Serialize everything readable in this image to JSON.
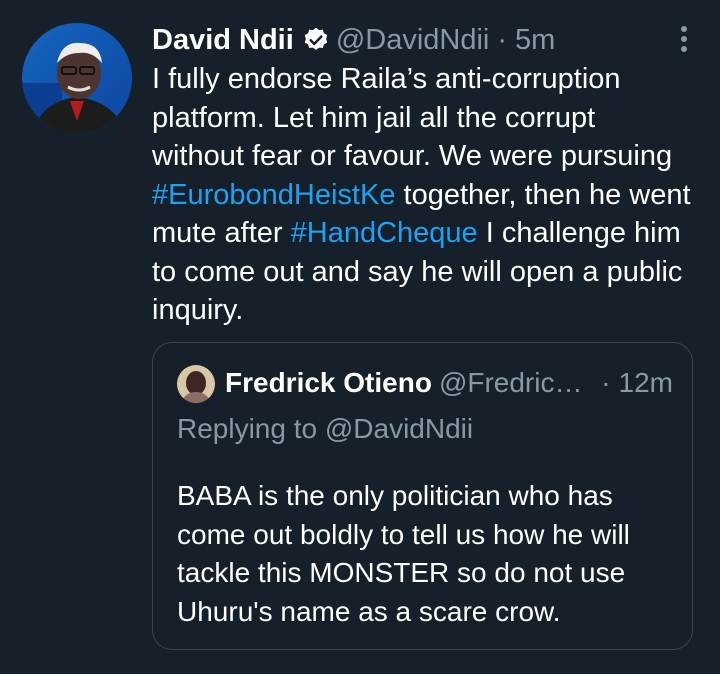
{
  "tweet": {
    "author_name": "David Ndii",
    "author_handle": "@DavidNdii",
    "separator": "·",
    "time": "5m",
    "verified": true,
    "more_icon": "more-vertical-icon",
    "text_parts": [
      "I fully endorse Raila’s anti-corruption platform.  Let him jail all the corrupt without fear or favour.  We were pursuing ",
      "#EurobondHeistKe",
      " together, then he went mute after ",
      "#HandCheque",
      " I challenge him to come out and say he will open a public inquiry."
    ]
  },
  "quote": {
    "author_name": "Fredrick Otieno",
    "author_handle": "@Fredric…",
    "separator": "·",
    "time": "12m",
    "replying_to": "Replying to @DavidNdii",
    "text": "BABA is the only politician who has come out boldly to tell us how he will tackle this MONSTER so do not use Uhuru's name as a scare crow."
  },
  "colors": {
    "background": "#15202b",
    "text": "#ffffff",
    "secondary": "#8899a6",
    "link": "#1da1f2",
    "border": "#38444d"
  }
}
